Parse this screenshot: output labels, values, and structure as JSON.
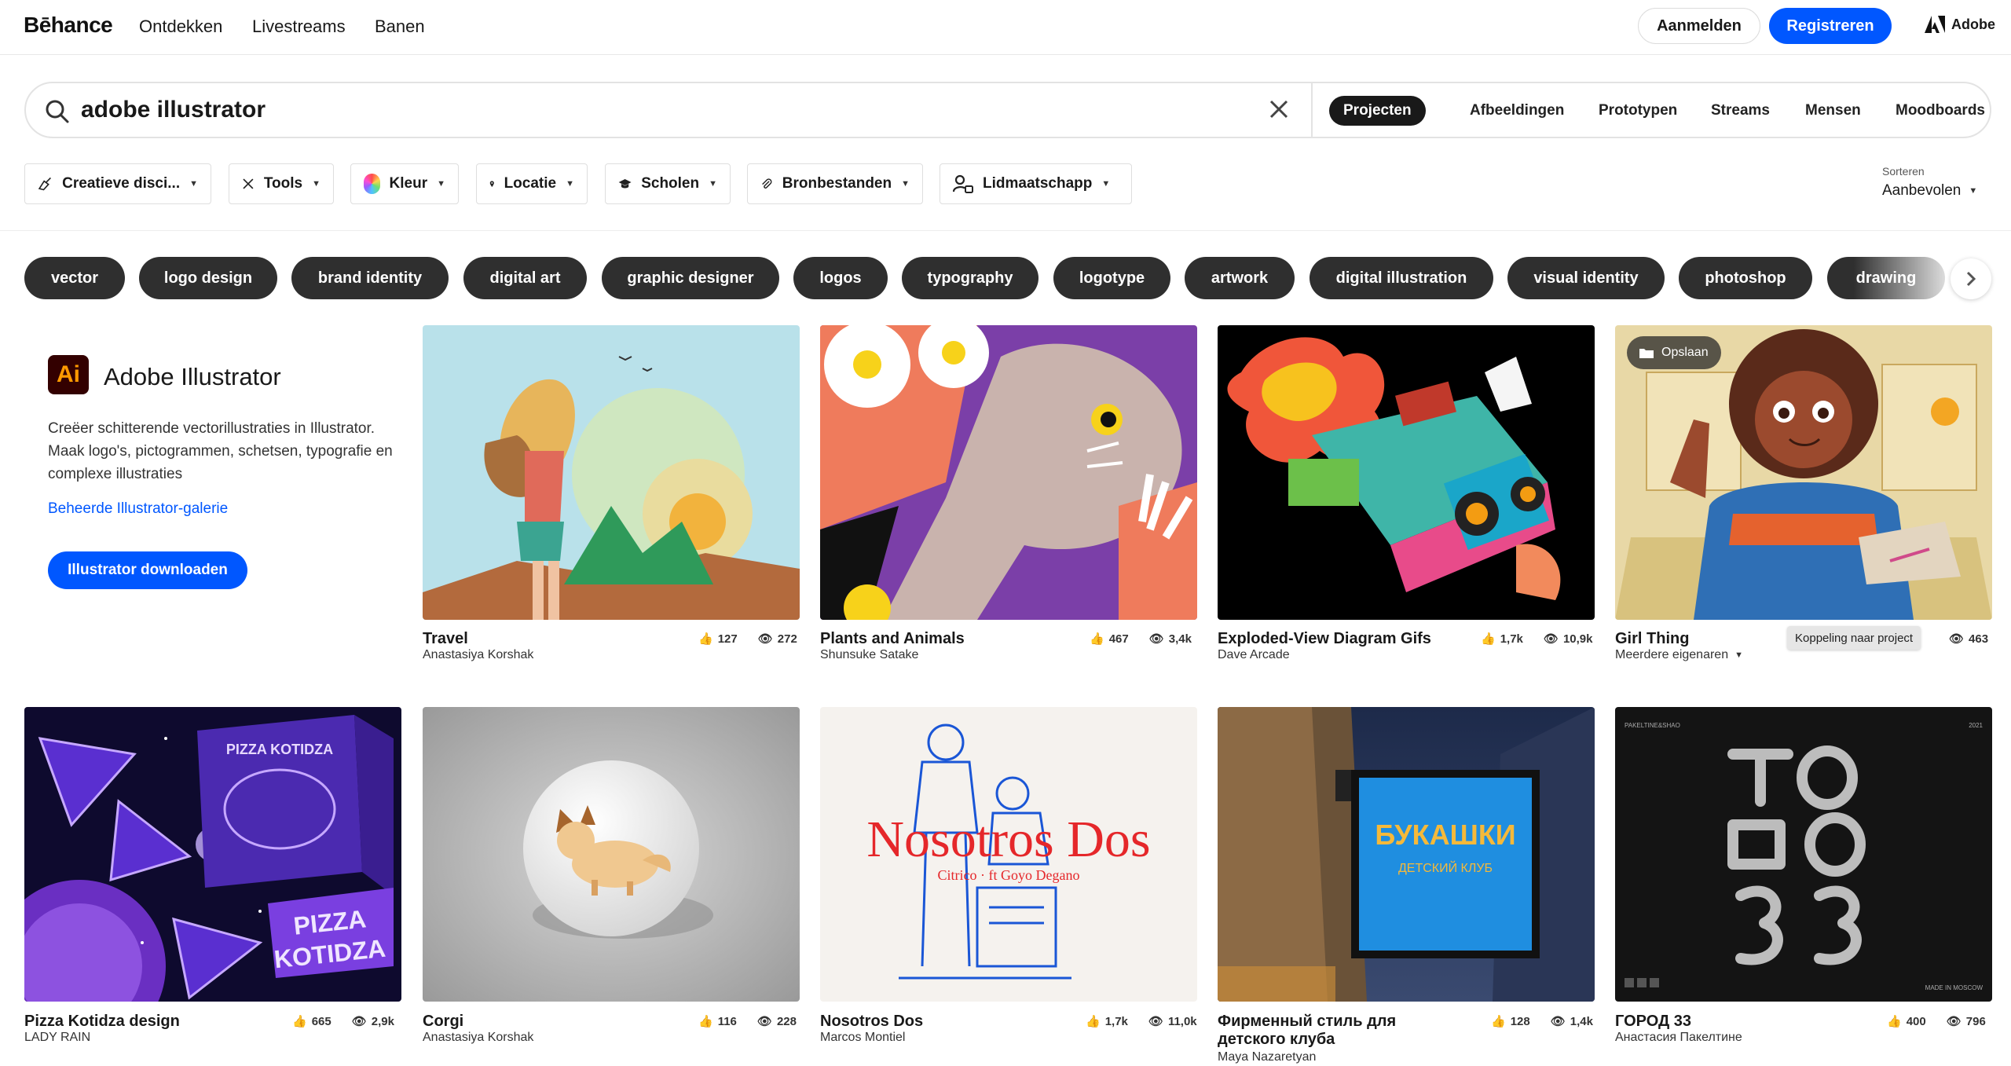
{
  "nav": {
    "logo": "Bēhance",
    "links": [
      "Ontdekken",
      "Livestreams",
      "Banen"
    ],
    "login": "Aanmelden",
    "register": "Registreren",
    "adobe": "Adobe"
  },
  "search": {
    "query": "adobe illustrator",
    "scopes": [
      "Projecten",
      "Afbeeldingen",
      "Prototypen",
      "Streams",
      "Mensen",
      "Moodboards"
    ],
    "active_scope": "Projecten"
  },
  "filters": [
    "Creatieve disci...",
    "Tools",
    "Kleur",
    "Locatie",
    "Scholen",
    "Bronbestanden",
    "Lidmaatschapp"
  ],
  "sort": {
    "label": "Sorteren",
    "value": "Aanbevolen"
  },
  "tags": [
    "vector",
    "logo design",
    "brand identity",
    "digital art",
    "graphic designer",
    "logos",
    "typography",
    "logotype",
    "artwork",
    "digital illustration",
    "visual identity",
    "photoshop",
    "drawing"
  ],
  "promo": {
    "logo_text": "Ai",
    "title": "Adobe Illustrator",
    "description": "Creëer schitterende vectorillustraties in Illustrator. Maak logo's, pictogrammen, schetsen, typografie en complexe illustraties",
    "link": "Beheerde Illustrator-galerie",
    "button": "Illustrator downloaden"
  },
  "projects": [
    {
      "title": "Travel",
      "owner": "Anastasiya Korshak",
      "likes": "127",
      "views": "272"
    },
    {
      "title": "Plants and Animals",
      "owner": "Shunsuke Satake",
      "likes": "467",
      "views": "3,4k"
    },
    {
      "title": "Exploded-View Diagram Gifs",
      "owner": "Dave Arcade",
      "likes": "1,7k",
      "views": "10,9k"
    },
    {
      "title": "Girl Thing",
      "owner": "Meerdere eigenaren",
      "likes": "",
      "views": "463"
    },
    {
      "title": "Pizza Kotidza design",
      "owner": "LADY RAIN",
      "likes": "665",
      "views": "2,9k"
    },
    {
      "title": "Corgi",
      "owner": "Anastasiya Korshak",
      "likes": "116",
      "views": "228"
    },
    {
      "title": "Nosotros Dos",
      "owner": "Marcos Montiel",
      "likes": "1,7k",
      "views": "11,0k"
    },
    {
      "title_line1": "Фирменный стиль для",
      "title_line2": "детского клуба",
      "owner": "Maya Nazaretyan",
      "likes": "128",
      "views": "1,4k"
    },
    {
      "title": "ГОРОД 33",
      "owner": "Анастасия Пакелтине",
      "likes": "400",
      "views": "796"
    }
  ],
  "overlays": {
    "save": "Opslaan",
    "tooltip": "Koppeling naar project"
  },
  "artwork_text": {
    "pizza_box": "PIZZA KOTIDZA",
    "pizza_sign_1": "PIZZA",
    "pizza_sign_2": "KOTIDZA",
    "nosotros": "Nosotros Dos",
    "nosotros_sub": "Citrico · ft Goyo Degano",
    "club_sign": "БУКАШКИ",
    "club_sub": "ДЕТСКИЙ КЛУБ",
    "gorod": "ГОРОД 33",
    "gorod_corner_left": "PAKELTINE&SHAO",
    "gorod_corner_right": "2021",
    "gorod_bottom": "MADE IN MOSCOW"
  }
}
